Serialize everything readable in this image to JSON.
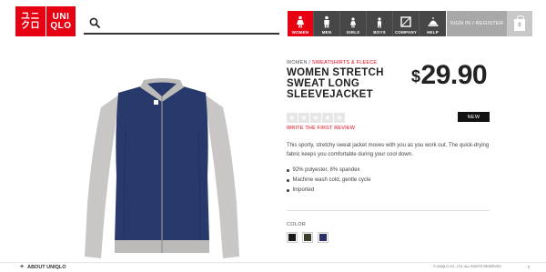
{
  "logo": {
    "row1": [
      "ユニ",
      "UNI"
    ],
    "row2": [
      "クロ",
      "QLO"
    ]
  },
  "search": {
    "placeholder": "",
    "icon": "search-icon"
  },
  "nav": [
    {
      "label": "WOMEN",
      "icon": "woman-icon",
      "active": true
    },
    {
      "label": "MEN",
      "icon": "man-icon",
      "active": false
    },
    {
      "label": "GIRLS",
      "icon": "girl-icon",
      "active": false
    },
    {
      "label": "BOYS",
      "icon": "boy-icon",
      "active": false
    },
    {
      "label": "COMPANY",
      "icon": "company-icon",
      "active": false
    },
    {
      "label": "HELP",
      "icon": "help-icon",
      "active": false
    }
  ],
  "account": {
    "signin_label": "SIGN IN / REGISTER",
    "cart_count": "0"
  },
  "product": {
    "breadcrumb_women": "WOMEN",
    "breadcrumb_sep": " / ",
    "breadcrumb_category": "SWEATSHIRTS & FLEECE",
    "title": "WOMEN STRETCH SWEAT LONG SLEEVEJACKET",
    "price_currency": "$",
    "price_amount": "29.90",
    "badge": "NEW",
    "review_link": "WRITE THE FIRST REVIEW",
    "rating": 0,
    "description": "This sporty, stretchy sweat jacket moves with you as you work out. The quick-drying fabric keeps you comfortable during your cool down.",
    "features": [
      "92% polyester, 8% spandex",
      "Machine wash cold, gentle cycle",
      "Imported"
    ],
    "color_label": "COLOR",
    "colors": [
      "#1a1a1a",
      "#3a3f2c",
      "#2b3068"
    ]
  },
  "footer": {
    "about": "ABOUT UNIQLO",
    "copyright": "© UNIQLO CO., LTD. ALL RIGHTS RESERVED"
  },
  "colors": {
    "brand_red": "#e60012",
    "nav_dark": "#464646",
    "navy": "#283a6b",
    "sleeve_gray": "#c9c6c6"
  }
}
